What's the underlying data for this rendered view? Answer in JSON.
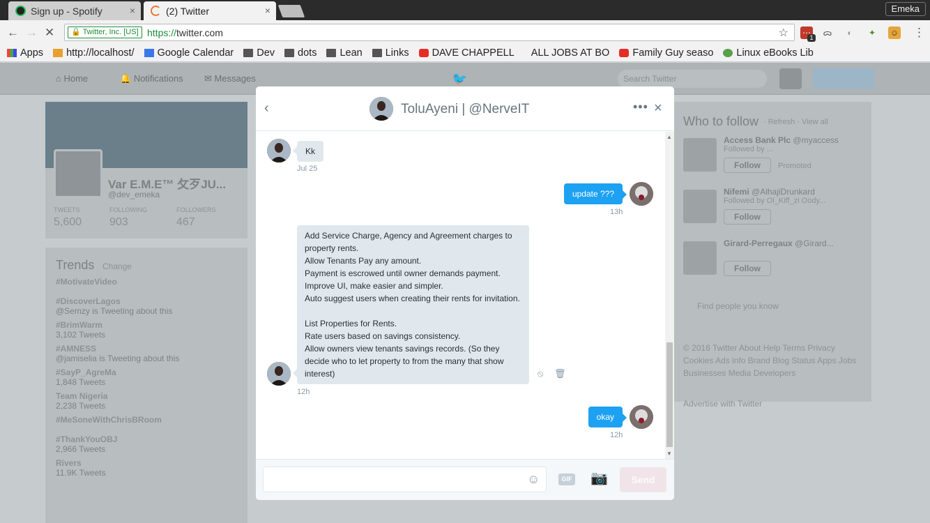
{
  "browser": {
    "tabs": [
      {
        "label": "Sign up - Spotify",
        "close": "×"
      },
      {
        "label": "(2) Twitter",
        "close": "×"
      }
    ],
    "user": "Emeka",
    "security_label": "Twitter, Inc. [US]",
    "url_proto": "https://",
    "url_host": "twitter.com",
    "bookmarks": [
      "Apps",
      "http://localhost/",
      "Google Calendar",
      "Dev",
      "dots",
      "Lean",
      "Links",
      "DAVE CHAPPELL",
      "ALL JOBS AT BO",
      "Family Guy seaso",
      "Linux eBooks Lib"
    ],
    "ext_badge": "1"
  },
  "twitter": {
    "nav": [
      "Home",
      "Notifications",
      "Messages"
    ],
    "search_placeholder": "Search Twitter",
    "profile": {
      "name": "Var E.M.E™ 攵歹JU...",
      "handle": "@dev_emeka",
      "stats": [
        {
          "label": "TWEETS",
          "value": "5,600"
        },
        {
          "label": "FOLLOWING",
          "value": "903"
        },
        {
          "label": "FOLLOWERS",
          "value": "467"
        }
      ]
    },
    "trends_title": "Trends",
    "trends_change": "Change",
    "trends": [
      {
        "name": "#MotivateVideo",
        "meta": ""
      },
      {
        "name": "#DiscoverLagos",
        "meta": "@Semzy is Tweeting about this"
      },
      {
        "name": "#BrimWarm",
        "meta": "3,102 Tweets"
      },
      {
        "name": "#AMNESS",
        "meta": "@jamiselia is Tweeting about this"
      },
      {
        "name": "#SayP_AgreMa",
        "meta": "1,848 Tweets"
      },
      {
        "name": "Team Nigeria",
        "meta": "2,238 Tweets"
      },
      {
        "name": "#MeSoneWithChrisBRoom",
        "meta": ""
      },
      {
        "name": "#ThankYouOBJ",
        "meta": "2,966 Tweets"
      },
      {
        "name": "Rivers",
        "meta": "11.9K Tweets"
      }
    ],
    "who_to_follow": {
      "title": "Who to follow",
      "links": "· Refresh · View all",
      "people": [
        {
          "name": "Access Bank Plc",
          "handle": "@myaccess",
          "meta": "Followed by ...",
          "follow": "Follow",
          "extra": "Promoted"
        },
        {
          "name": "Nifemi",
          "handle": "@AlhajiDrunkard",
          "meta": "Followed by Ol_Kiff_zi Oody...",
          "follow": "Follow",
          "extra": ""
        },
        {
          "name": "Girard-Perregaux",
          "handle": "@Girard...",
          "meta": "",
          "follow": "Follow",
          "extra": ""
        }
      ],
      "find_people": "Find people you know"
    },
    "footer_links": "© 2016 Twitter About Help Terms Privacy Cookies Ads info Brand Blog Status Apps Jobs Businesses Media Developers",
    "advertise": "Advertise with Twitter"
  },
  "dm": {
    "title": "ToluAyeni | @NerveIT",
    "back_icon": "‹",
    "more_icon": "•••",
    "close_icon": "×",
    "messages": [
      {
        "from": "them",
        "text": "Kk",
        "time": "Jul 25"
      },
      {
        "from": "me",
        "text": "update ???",
        "time": "13h"
      },
      {
        "from": "them",
        "lines": [
          "Add Service Charge, Agency and Agreement charges to",
          "property rents.",
          "Allow Tenants Pay any amount.",
          "Payment is escrowed until owner demands payment.",
          "Improve UI, make easier and simpler.",
          "Auto suggest users when creating their rents for invitation.",
          "",
          "List Properties for Rents.",
          "Rate users based on savings consistency.",
          "Allow owners view tenants savings records. (So they",
          "decide who to let property to from the many that show",
          "interest)"
        ],
        "time": "12h"
      },
      {
        "from": "me",
        "text": "okay",
        "time": "12h"
      }
    ],
    "compose": {
      "placeholder": "",
      "gif_label": "GIF",
      "send_label": "Send"
    }
  }
}
